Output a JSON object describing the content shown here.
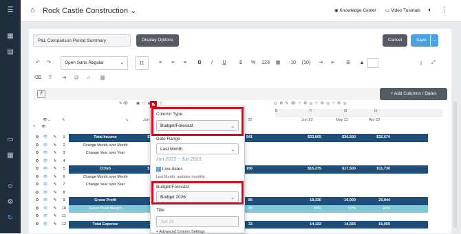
{
  "app": {
    "company": "Rock Castle Construction",
    "knowledge_center": "Knowledge Center",
    "video_tutorials": "Video Tutorials"
  },
  "report": {
    "name": "P&L Comparison Period Summary",
    "display_options": "Display Options",
    "cancel": "Cancel",
    "save": "Save"
  },
  "toolbar": {
    "font": "Open Sans Regular",
    "size": "11",
    "dollar": "$",
    "percent": "%",
    "num": "123",
    "neg1": "-10",
    "neg2": "(10)",
    "add_columns": "+ Add Columns / Dates"
  },
  "columns": {
    "letters": [
      "E",
      "F",
      "G",
      "H"
    ],
    "dates": [
      "Jun 22",
      "May 22",
      "Apr 22"
    ],
    "partial": "Jun",
    "partial2": "23"
  },
  "rows": [
    {
      "n": "1",
      "label": "Total Income",
      "v1": "$50,",
      "v2": "541",
      "f": "$33,605",
      "g": "$36,500",
      "h": "$32,674",
      "style": "dark"
    },
    {
      "n": "2",
      "label": "Change Month over Month",
      "style": "plain"
    },
    {
      "n": "3",
      "label": "Change Year over Year",
      "style": "plain"
    },
    {
      "n": "4",
      "label": "",
      "style": "plain"
    },
    {
      "n": "5",
      "label": "COGS",
      "v1": "$13,",
      "v2": "156",
      "f": "$15,275",
      "g": "$17,500",
      "h": "$11,730",
      "style": "dark"
    },
    {
      "n": "6",
      "label": "Change Month over Month",
      "style": "plain"
    },
    {
      "n": "7",
      "label": "Change Year over Year",
      "style": "plain"
    },
    {
      "n": "8",
      "label": "",
      "style": "plain"
    },
    {
      "n": "9",
      "label": "Gross Profit",
      "v1": "37,",
      "v2": "85",
      "f": "18,330",
      "g": "19,000",
      "h": "20,944",
      "style": "dark"
    },
    {
      "n": "10",
      "label": "Gross Profit Margin",
      "v2": "85",
      "f": "55%",
      "g": "52%",
      "h": "64%",
      "style": "light"
    },
    {
      "n": "11",
      "label": "",
      "style": "plain"
    },
    {
      "n": "12",
      "label": "Total Expense",
      "v1": "27,",
      "v2": "33",
      "f": "14,122",
      "g": "14,665",
      "h": "15,059",
      "style": "dark"
    }
  ],
  "popup": {
    "column_type_label": "Column Type",
    "column_type_value": "Budget/Forecast",
    "date_range_label": "Date Range",
    "date_range_value": "Last Month",
    "date_range_text": "Jun 2023 ~ Jun 2023",
    "live_dates": "Live dates",
    "live_note": "Last Month: updates monthly",
    "budget_label": "Budget/Forecast",
    "budget_value": "Budget 2026",
    "title_label": "Title",
    "title_placeholder": "Jun 23",
    "advanced": "+ Advanced Column Settings"
  },
  "colors": {
    "accent": "#4aa3df",
    "band_dark": "#1f4e79",
    "band_light": "#7fc8d8",
    "highlight": "#e0001b"
  }
}
